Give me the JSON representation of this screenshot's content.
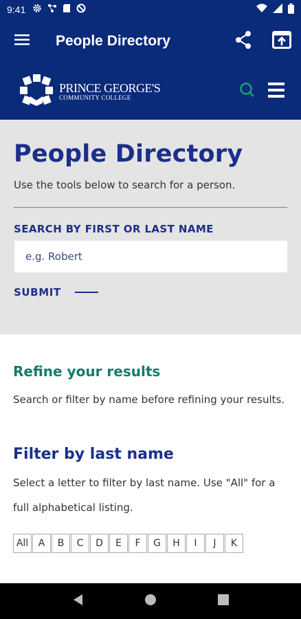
{
  "status_bar": {
    "time": "9:41"
  },
  "app_bar": {
    "title": "People Directory"
  },
  "site_header": {
    "logo_line1": "PRINCE GEORGE'S",
    "logo_line2": "COMMUNITY COLLEGE"
  },
  "search_panel": {
    "title": "People Directory",
    "intro": "Use the tools below to search for a person.",
    "search_label": "SEARCH BY FIRST OR LAST NAME",
    "search_placeholder": "e.g. Robert",
    "submit_label": "SUBMIT"
  },
  "refine": {
    "heading": "Refine your results",
    "text": "Search or filter by name before refining your results."
  },
  "filter": {
    "heading": "Filter by last name",
    "text": "Select a letter to filter by last name. Use \"All\" for a full alphabetical listing.",
    "letters": [
      "All",
      "A",
      "B",
      "C",
      "D",
      "E",
      "F",
      "G",
      "H",
      "I",
      "J",
      "K"
    ]
  },
  "colors": {
    "brand_blue": "#0a2a7a",
    "heading_blue": "#1b2f8a",
    "accent_green": "#127c6a"
  },
  "icons": {
    "status": [
      "gear-icon",
      "network-icon",
      "sd-card-icon",
      "blocked-icon"
    ],
    "status_right": [
      "wifi-icon",
      "signal-icon",
      "battery-icon"
    ],
    "app_bar": [
      "menu-icon",
      "share-icon",
      "open-external-icon"
    ],
    "site_header": [
      "search-icon",
      "menu-icon"
    ],
    "nav": [
      "back-icon",
      "home-icon",
      "recents-icon"
    ]
  }
}
